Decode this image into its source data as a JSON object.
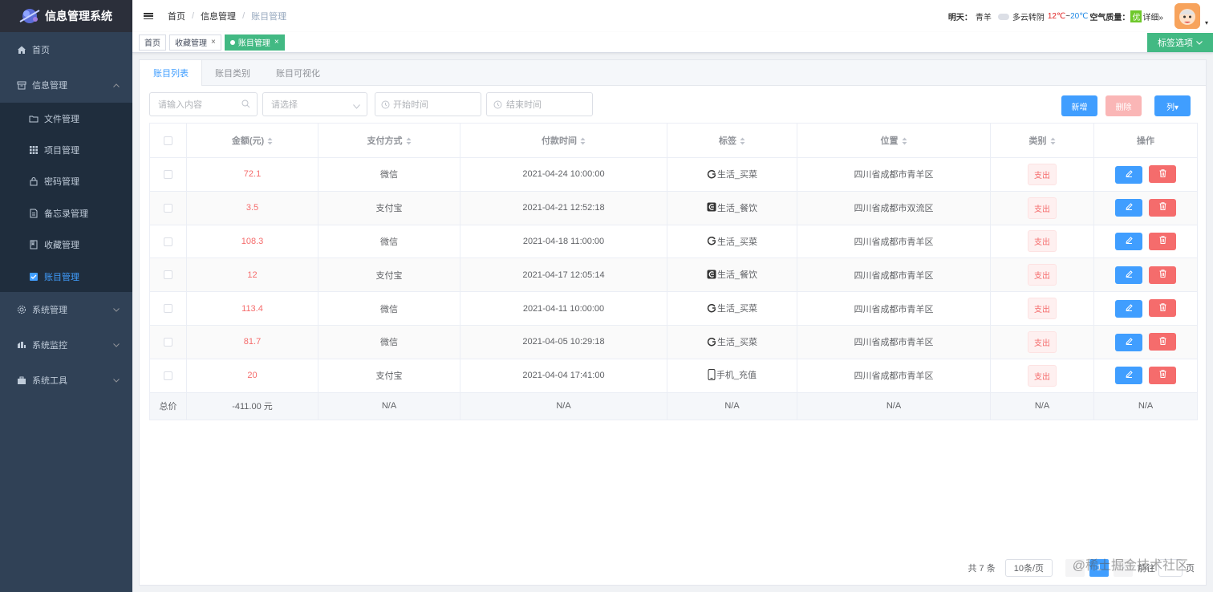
{
  "app": {
    "title": "信息管理系统"
  },
  "sidebar": {
    "items": [
      {
        "label": "首页",
        "icon": "home-icon"
      },
      {
        "label": "信息管理",
        "icon": "archive-icon",
        "expanded": true
      },
      {
        "label": "系统管理",
        "icon": "gear-icon"
      },
      {
        "label": "系统监控",
        "icon": "monitor-icon"
      },
      {
        "label": "系统工具",
        "icon": "toolbox-icon"
      }
    ],
    "sub_items": [
      {
        "label": "文件管理",
        "icon": "folder-icon"
      },
      {
        "label": "项目管理",
        "icon": "grid-icon"
      },
      {
        "label": "密码管理",
        "icon": "lock-icon"
      },
      {
        "label": "备忘录管理",
        "icon": "document-icon"
      },
      {
        "label": "收藏管理",
        "icon": "bookmark-icon"
      },
      {
        "label": "账目管理",
        "icon": "checkbox-icon",
        "active": true
      }
    ]
  },
  "breadcrumb": {
    "home": "首页",
    "parent": "信息管理",
    "current": "账目管理"
  },
  "weather": {
    "label": "明天：",
    "city": "青羊",
    "desc": "多云转阴",
    "high": "12℃",
    "tilde": "~",
    "low": "20℃",
    "aq_label": "空气质量：",
    "aq_value": "优",
    "detail": "详细»"
  },
  "tags": {
    "items": [
      {
        "label": "首页",
        "closable": false,
        "active": false
      },
      {
        "label": "收藏管理",
        "closable": true,
        "active": false
      },
      {
        "label": "账目管理",
        "closable": true,
        "active": true
      }
    ],
    "close_glyph": "×",
    "options_label": "标签选项"
  },
  "tabs": [
    {
      "label": "账目列表",
      "active": true
    },
    {
      "label": "账目类别",
      "active": false
    },
    {
      "label": "账目可视化",
      "active": false
    }
  ],
  "filters": {
    "search_placeholder": "请输入内容",
    "select_placeholder": "请选择",
    "start_placeholder": "开始时间",
    "end_placeholder": "结束时间"
  },
  "actions": {
    "add": "新增",
    "delete": "删除",
    "columns": "列▾"
  },
  "table": {
    "headers": {
      "amount": "金额(元)",
      "method": "支付方式",
      "time": "付款时间",
      "tag": "标签",
      "location": "位置",
      "category": "类别",
      "ops": "操作"
    },
    "rows": [
      {
        "amount": "72.1",
        "method": "微信",
        "time": "2021-04-24 10:00:00",
        "tag": "生活_买菜",
        "tag_icon": "refresh-icon",
        "location": "四川省成都市青羊区",
        "category": "支出"
      },
      {
        "amount": "3.5",
        "method": "支付宝",
        "time": "2021-04-21 12:52:18",
        "tag": "生活_餐饮",
        "tag_icon": "dining-icon",
        "location": "四川省成都市双流区",
        "category": "支出"
      },
      {
        "amount": "108.3",
        "method": "微信",
        "time": "2021-04-18 11:00:00",
        "tag": "生活_买菜",
        "tag_icon": "refresh-icon",
        "location": "四川省成都市青羊区",
        "category": "支出"
      },
      {
        "amount": "12",
        "method": "支付宝",
        "time": "2021-04-17 12:05:14",
        "tag": "生活_餐饮",
        "tag_icon": "dining-icon",
        "location": "四川省成都市青羊区",
        "category": "支出"
      },
      {
        "amount": "113.4",
        "method": "微信",
        "time": "2021-04-11 10:00:00",
        "tag": "生活_买菜",
        "tag_icon": "refresh-icon",
        "location": "四川省成都市青羊区",
        "category": "支出"
      },
      {
        "amount": "81.7",
        "method": "微信",
        "time": "2021-04-05 10:29:18",
        "tag": "生活_买菜",
        "tag_icon": "refresh-icon",
        "location": "四川省成都市青羊区",
        "category": "支出"
      },
      {
        "amount": "20",
        "method": "支付宝",
        "time": "2021-04-04 17:41:00",
        "tag": "手机_充值",
        "tag_icon": "phone-icon",
        "location": "四川省成都市青羊区",
        "category": "支出"
      }
    ],
    "summary": {
      "label": "总价",
      "amount": "-411.00 元",
      "method": "N/A",
      "time": "N/A",
      "tag": "N/A",
      "location": "N/A",
      "category": "N/A",
      "ops": "N/A"
    }
  },
  "pagination": {
    "total": "共 7 条",
    "page_size": "10条/页",
    "current_page": "1",
    "goto_prefix": "前往",
    "goto_suffix": "页"
  },
  "watermark": "@稀土掘金技术社区",
  "colors": {
    "sidebar_bg": "#304156",
    "submenu_bg": "#1f2d3d",
    "active_text": "#409eff",
    "tag_active": "#42b983",
    "primary": "#409eff",
    "danger": "#f56c6c",
    "danger_light": "#fab6b6"
  }
}
